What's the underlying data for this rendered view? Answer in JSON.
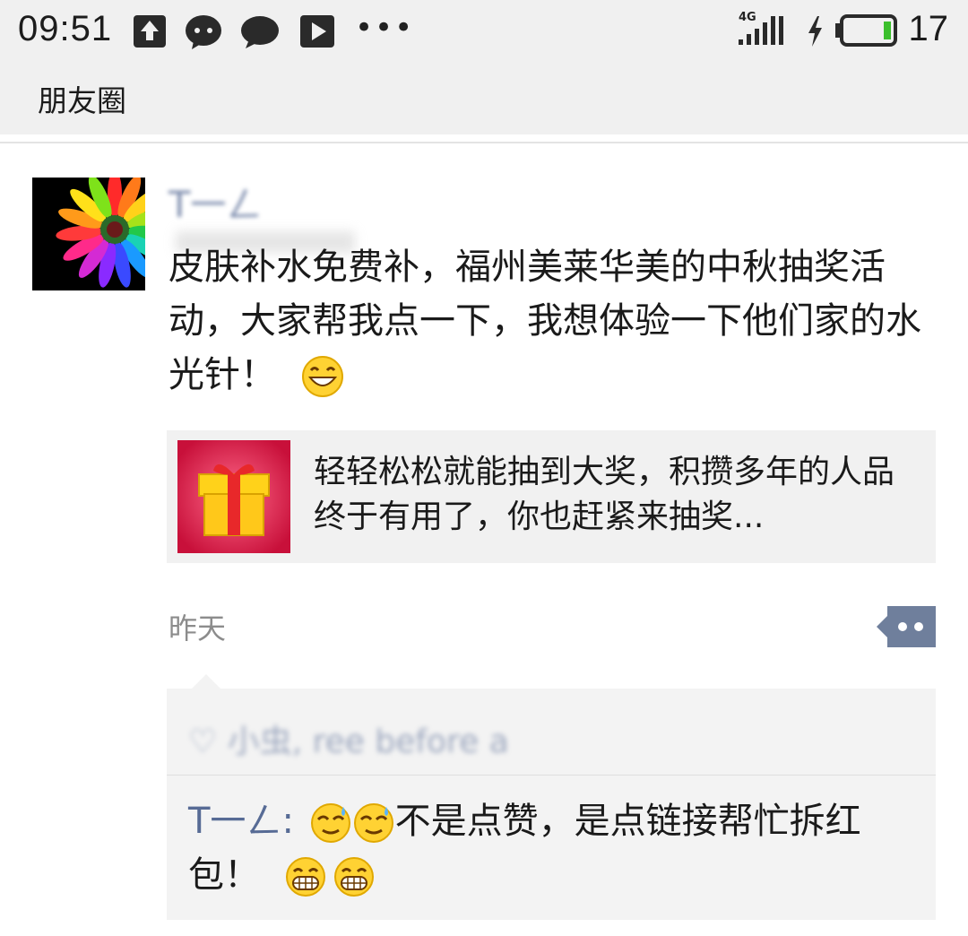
{
  "status_bar": {
    "time": "09:51",
    "network": "4G",
    "battery_percent": "17",
    "more": "•••",
    "icons": [
      "upload-icon",
      "chat-bubble-icon",
      "message-icon",
      "play-icon",
      "signal-icon",
      "charging-icon",
      "battery-icon"
    ]
  },
  "header": {
    "title": "朋友圈"
  },
  "post": {
    "author": "T一ㄥ",
    "text": "皮肤补水免费补，福州美莱华美的中秋抽奖活动，大家帮我点一下，我想体验一下他们家的水光针！",
    "emoji": "grinning-face-icon",
    "link": {
      "title": "轻轻松松就能抽到大奖，积攒多年的人品终于有用了，你也赶紧来抽奖..."
    },
    "timestamp": "昨天"
  },
  "comments": {
    "likes_text": "♡ 小虫, ree before a",
    "items": [
      {
        "author": "T一ㄥ",
        "separator": ":",
        "text": "不是点赞，是点链接帮忙拆红包！",
        "emojis": [
          "sweat-smile-icon",
          "grin-teeth-icon"
        ]
      }
    ]
  },
  "colors": {
    "link_blue": "#576b95",
    "bg_gray": "#f0f0f0",
    "card_gray": "#f1f1f1"
  }
}
